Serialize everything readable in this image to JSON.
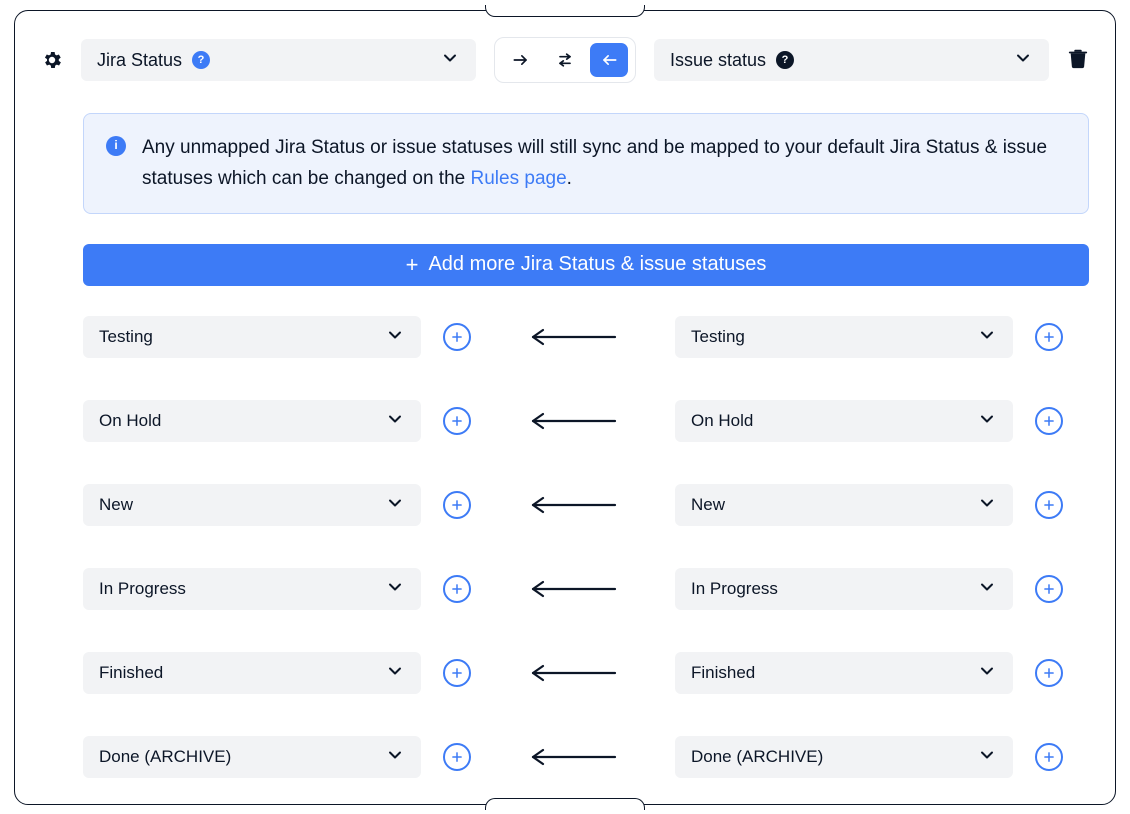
{
  "header": {
    "left_field": "Jira Status",
    "right_field": "Issue status"
  },
  "direction": {
    "active": "left"
  },
  "callout": {
    "text_a": "Any unmapped Jira Status or issue statuses will still sync and be mapped to your default Jira Status & issue statuses which can be changed on the ",
    "link": "Rules page",
    "text_b": "."
  },
  "add_button": "Add more Jira Status & issue statuses",
  "mappings": [
    {
      "left": "Testing",
      "right": "Testing"
    },
    {
      "left": "On Hold",
      "right": "On Hold"
    },
    {
      "left": "New",
      "right": "New"
    },
    {
      "left": "In Progress",
      "right": "In Progress"
    },
    {
      "left": "Finished",
      "right": "Finished"
    },
    {
      "left": "Done (ARCHIVE)",
      "right": "Done (ARCHIVE)"
    }
  ]
}
